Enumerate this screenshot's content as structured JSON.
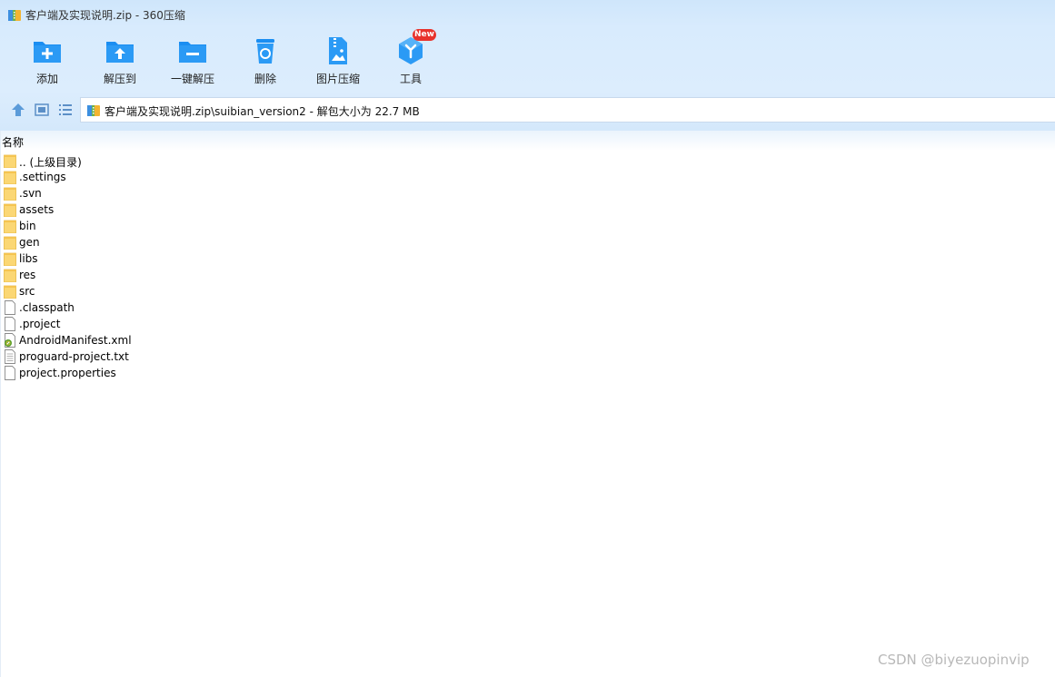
{
  "window": {
    "title": "客户端及实现说明.zip - 360压缩",
    "app_icon": "archive-icon"
  },
  "toolbar": {
    "items": [
      {
        "label": "添加",
        "icon": "add-folder-icon"
      },
      {
        "label": "解压到",
        "icon": "extract-to-folder-icon"
      },
      {
        "label": "一键解压",
        "icon": "one-click-extract-folder-icon"
      },
      {
        "label": "删除",
        "icon": "recycle-bin-icon"
      },
      {
        "label": "图片压缩",
        "icon": "image-compress-icon"
      },
      {
        "label": "工具",
        "icon": "tools-cube-icon",
        "badge": "New"
      }
    ],
    "accent_color": "#1a8ef2",
    "badge_color": "#e8322c"
  },
  "nav": {
    "buttons": [
      "up-arrow-icon",
      "thumbnail-view-icon",
      "list-view-icon"
    ],
    "path": "客户端及实现说明.zip\\suibian_version2 - 解包大小为 22.7 MB"
  },
  "list": {
    "column_name": "名称",
    "files": [
      {
        "name": ".. (上级目录)",
        "type": "folder"
      },
      {
        "name": ".settings",
        "type": "folder"
      },
      {
        "name": ".svn",
        "type": "folder"
      },
      {
        "name": "assets",
        "type": "folder"
      },
      {
        "name": "bin",
        "type": "folder"
      },
      {
        "name": "gen",
        "type": "folder"
      },
      {
        "name": "libs",
        "type": "folder"
      },
      {
        "name": "res",
        "type": "folder"
      },
      {
        "name": "src",
        "type": "folder"
      },
      {
        "name": ".classpath",
        "type": "file"
      },
      {
        "name": ".project",
        "type": "file"
      },
      {
        "name": "AndroidManifest.xml",
        "type": "xml"
      },
      {
        "name": "proguard-project.txt",
        "type": "text"
      },
      {
        "name": "project.properties",
        "type": "file"
      }
    ]
  },
  "watermark": "CSDN @biyezuopinvip"
}
